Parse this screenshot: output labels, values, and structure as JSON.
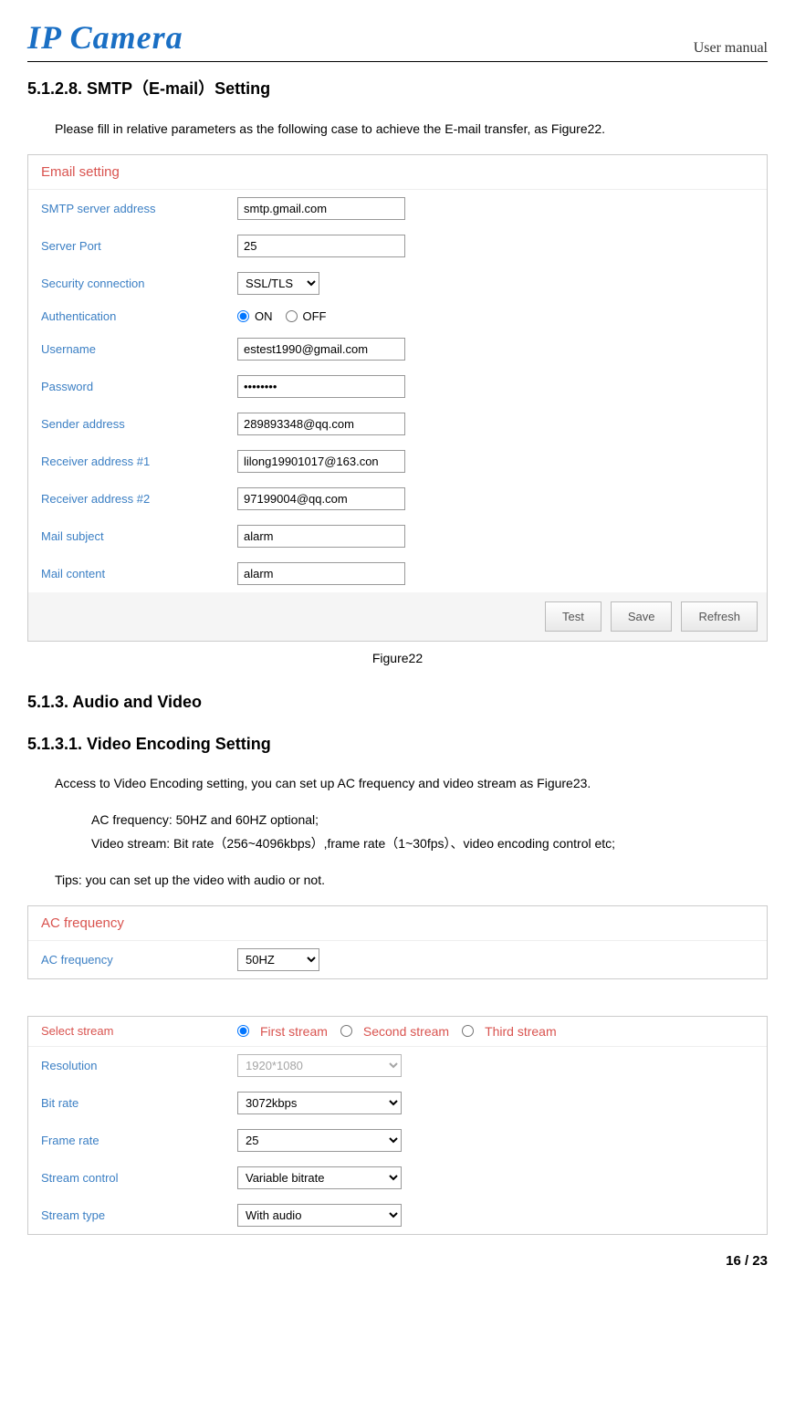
{
  "header": {
    "logo": "IP Camera",
    "right": "User manual"
  },
  "section1": {
    "title": "5.1.2.8. SMTP（E-mail）Setting",
    "intro": "Please fill in relative parameters as the following case to achieve the E-mail transfer, as Figure22.",
    "panel_title": "Email setting",
    "rows": {
      "smtp_server_label": "SMTP server address",
      "smtp_server_value": "smtp.gmail.com",
      "server_port_label": "Server Port",
      "server_port_value": "25",
      "security_label": "Security connection",
      "security_value": "SSL/TLS",
      "auth_label": "Authentication",
      "auth_on": "ON",
      "auth_off": "OFF",
      "username_label": "Username",
      "username_value": "estest1990@gmail.com",
      "password_label": "Password",
      "password_value": "••••••••",
      "sender_label": "Sender address",
      "sender_value": "289893348@qq.com",
      "receiver1_label": "Receiver address #1",
      "receiver1_value": "lilong19901017@163.con",
      "receiver2_label": "Receiver address #2",
      "receiver2_value": "97199004@qq.com",
      "subject_label": "Mail subject",
      "subject_value": "alarm",
      "content_label": "Mail content",
      "content_value": "alarm"
    },
    "buttons": {
      "test": "Test",
      "save": "Save",
      "refresh": "Refresh"
    },
    "caption": "Figure22"
  },
  "section2": {
    "title": "5.1.3.  Audio and Video",
    "subtitle": "5.1.3.1. Video Encoding Setting",
    "intro": "Access to Video Encoding setting, you can set up AC frequency and video stream as Figure23.",
    "line1": "AC frequency: 50HZ and 60HZ optional;",
    "line2": "Video stream: Bit rate（256~4096kbps）,frame rate（1~30fps）、video encoding control etc;",
    "tips": "Tips: you can set up the video with audio or not.",
    "ac_panel_title": "AC frequency",
    "ac_label": "AC frequency",
    "ac_value": "50HZ",
    "stream_panel_title": "Select stream",
    "stream_first": "First stream",
    "stream_second": "Second stream",
    "stream_third": "Third stream",
    "resolution_label": "Resolution",
    "resolution_value": "1920*1080",
    "bitrate_label": "Bit rate",
    "bitrate_value": "3072kbps",
    "framerate_label": "Frame rate",
    "framerate_value": "25",
    "streamcontrol_label": "Stream control",
    "streamcontrol_value": "Variable bitrate",
    "streamtype_label": "Stream type",
    "streamtype_value": "With audio"
  },
  "footer": {
    "page": "16 / 23"
  }
}
